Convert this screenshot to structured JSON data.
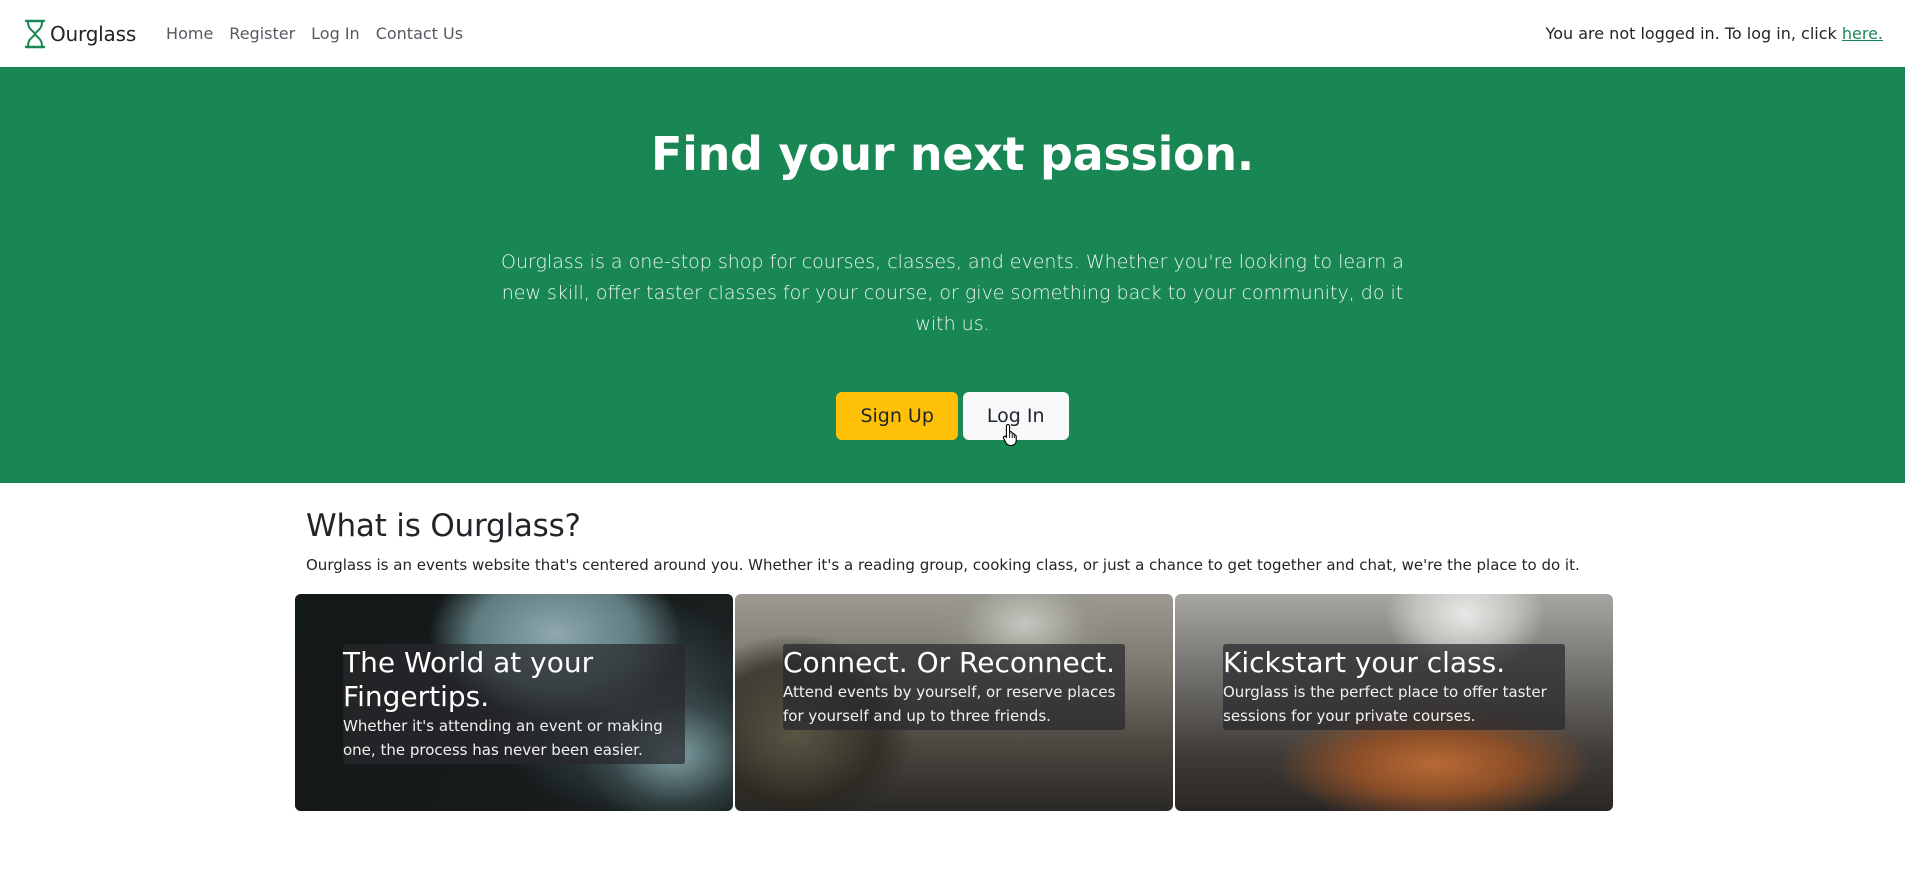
{
  "navbar": {
    "brand": "Ourglass",
    "links": [
      "Home",
      "Register",
      "Log In",
      "Contact Us"
    ],
    "status_text": "You are not logged in. To log in, click ",
    "status_link": "here."
  },
  "hero": {
    "title": "Find your next passion.",
    "lead": "Ourglass is a one-stop shop for courses, classes, and events. Whether you're looking to learn a new skill, offer taster classes for your course, or give something back to your community, do it with us.",
    "signup_label": "Sign Up",
    "login_label": "Log In"
  },
  "about": {
    "title": "What is Ourglass?",
    "text": "Ourglass is an events website that's centered around you. Whether it's a reading group, cooking class, or just a chance to get together and chat, we're the place to do it."
  },
  "cards": [
    {
      "title": "The World at your Fingertips.",
      "text": "Whether it's attending an event or making one, the process has never been easier."
    },
    {
      "title": "Connect. Or Reconnect.",
      "text": "Attend events by yourself, or reserve places for yourself and up to three friends."
    },
    {
      "title": "Kickstart your class.",
      "text": "Ourglass is the perfect place to offer taster sessions for your private courses."
    }
  ],
  "colors": {
    "primary_green": "#198754",
    "warning_yellow": "#ffc107",
    "light": "#f8f9fa"
  },
  "icons": {
    "brand": "hourglass-icon",
    "cursor": "hand-pointer-icon"
  }
}
